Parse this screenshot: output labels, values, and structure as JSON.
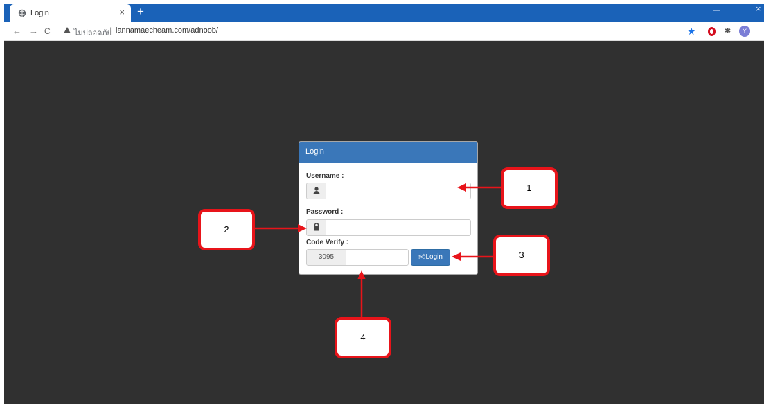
{
  "browser": {
    "tab_title": "Login",
    "tab_close": "×",
    "new_tab": "+",
    "back": "←",
    "forward": "→",
    "reload": "C",
    "security_label": "ไม่ปลอดภัย",
    "url_separator": "|",
    "url": "lannamaecheam.com/adnoob/",
    "profile_initial": "Y",
    "window_minimize": "—",
    "window_restore": "□",
    "window_close": "×"
  },
  "login": {
    "heading": "Login",
    "username_label": "Username :",
    "username_value": "",
    "password_label": "Password :",
    "password_value": "",
    "code_label": "Code Verify :",
    "code_value": "3095",
    "code_input_value": "",
    "login_button": "Login"
  },
  "annotations": {
    "callout_1": "1",
    "callout_2": "2",
    "callout_3": "3",
    "callout_4": "4",
    "color": "#e8141a"
  },
  "colors": {
    "tabstrip": "#1a62b8",
    "page_background": "#303030",
    "panel_heading": "#3a77b9",
    "login_button": "#3a77b9"
  }
}
